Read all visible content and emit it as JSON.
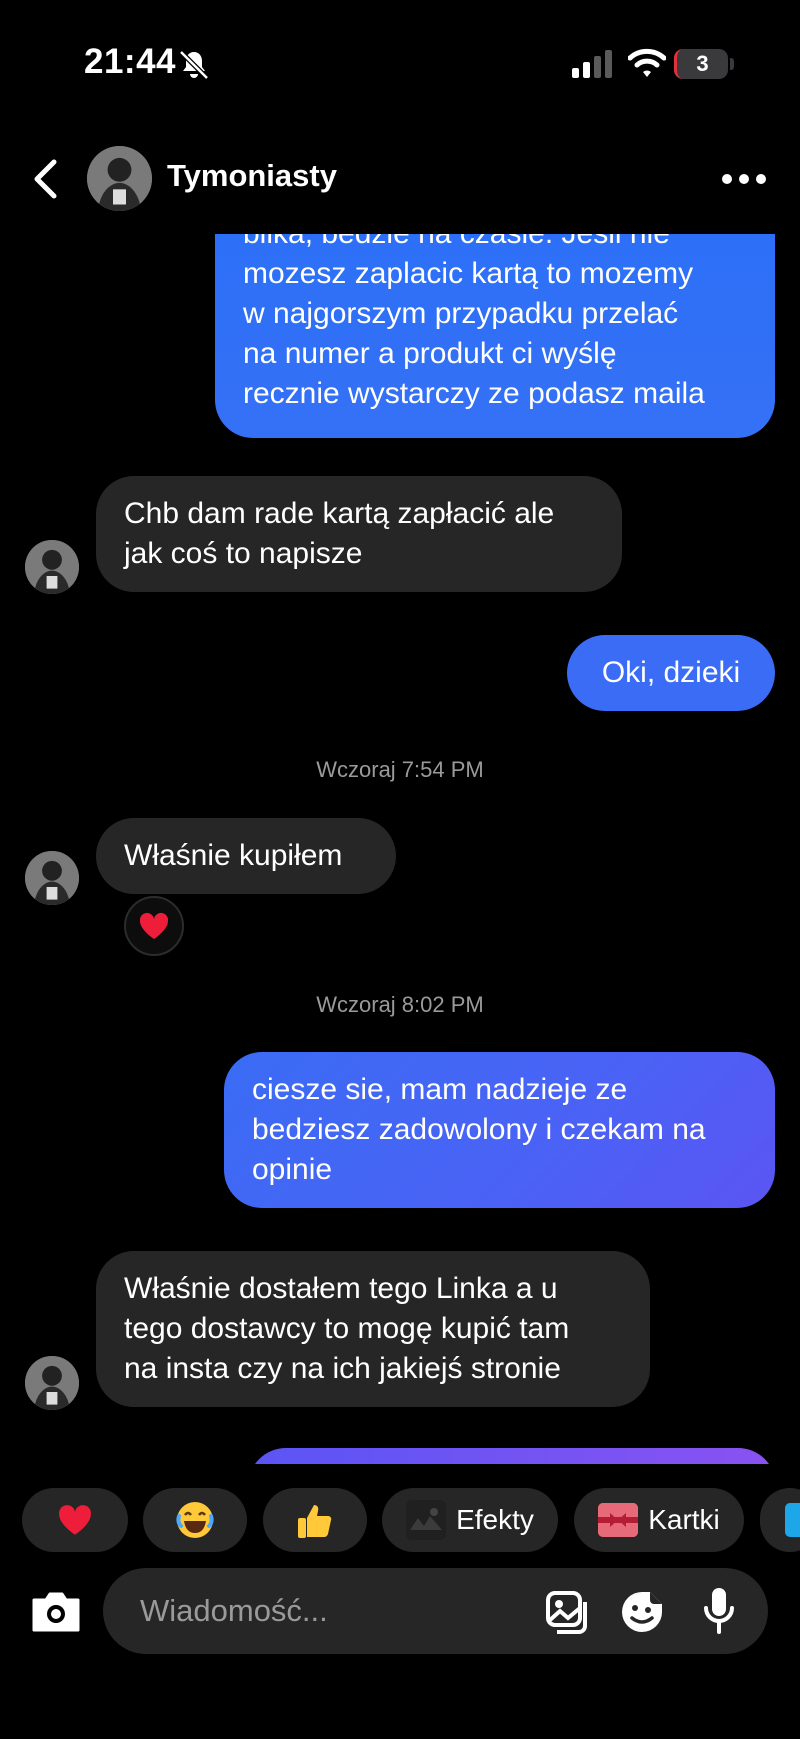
{
  "status_bar": {
    "time": "21:44",
    "battery": "3"
  },
  "header": {
    "contact_name": "Tymoniasty"
  },
  "messages": [
    {
      "side": "out",
      "lines": [
        "blika, bedzie na czasie. Jesli nie",
        "mozesz zaplacic kartą to mozemy",
        "w najgorszym przypadku przelać",
        "na numer a produkt ci wyślę",
        "recznie wystarczy ze podasz maila"
      ]
    },
    {
      "side": "in",
      "lines": [
        "Chb dam rade kartą zapłacić ale",
        "jak coś to napisze"
      ]
    },
    {
      "side": "out",
      "lines": [
        "Oki, dzieki"
      ]
    },
    {
      "timestamp": "Wczoraj 7:54 PM"
    },
    {
      "side": "in",
      "lines": [
        "Właśnie kupiłem"
      ],
      "reaction": "heart"
    },
    {
      "timestamp": "Wczoraj 8:02 PM"
    },
    {
      "side": "out",
      "lines": [
        "ciesze sie, mam nadzieje ze",
        "bedziesz zadowolony i czekam na",
        "opinie"
      ]
    },
    {
      "side": "in",
      "lines": [
        "Właśnie dostałem tego Linka a u",
        "tego dostawcy to mogę kupić tam",
        "na insta czy na ich jakiejś stronie"
      ]
    }
  ],
  "quick_reactions": [
    {
      "icon": "heart-icon"
    },
    {
      "icon": "laughing-face-icon"
    },
    {
      "icon": "thumbs-up-icon"
    },
    {
      "icon": "effects-icon",
      "label": "Efekty"
    },
    {
      "icon": "card-icon",
      "label": "Kartki"
    }
  ],
  "composer": {
    "placeholder": "Wiadomość..."
  },
  "colors": {
    "outgoing": "#3a6cf5",
    "outgoing_gradient_end": "#5b55f4",
    "incoming": "#262626",
    "background": "#000000",
    "heart": "#ee1d3a"
  }
}
